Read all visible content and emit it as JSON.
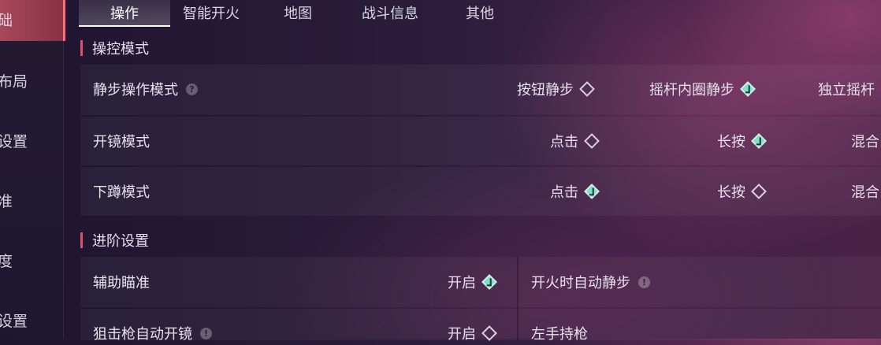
{
  "sidebar": {
    "items": [
      {
        "label": "础"
      },
      {
        "label": "布局"
      },
      {
        "label": "设置"
      },
      {
        "label": "准"
      },
      {
        "label": "度"
      },
      {
        "label": "设置"
      }
    ]
  },
  "tabs": [
    {
      "label": "操作"
    },
    {
      "label": "智能开火"
    },
    {
      "label": "地图"
    },
    {
      "label": "战斗信息"
    },
    {
      "label": "其他"
    }
  ],
  "sections": {
    "control_mode": {
      "title": "操控模式",
      "rows": [
        {
          "label": "静步操作模式",
          "help_icon": "?",
          "options": [
            {
              "label": "按钮静步",
              "checked": false
            },
            {
              "label": "摇杆内圈静步",
              "checked": true
            },
            {
              "label": "独立摇杆",
              "checked": false
            }
          ]
        },
        {
          "label": "开镜模式",
          "options": [
            {
              "label": "点击",
              "checked": false
            },
            {
              "label": "长按",
              "checked": true
            },
            {
              "label": "混合",
              "checked": false
            }
          ]
        },
        {
          "label": "下蹲模式",
          "options": [
            {
              "label": "点击",
              "checked": true
            },
            {
              "label": "长按",
              "checked": false
            },
            {
              "label": "混合",
              "checked": false
            }
          ]
        }
      ]
    },
    "advanced": {
      "title": "进阶设置",
      "rows": [
        {
          "label": "辅助瞄准",
          "option": {
            "label": "开启",
            "checked": true
          },
          "right_label": "开火时自动静步",
          "right_icon": "!"
        },
        {
          "label": "狙击枪自动开镜",
          "icon": "!",
          "option": {
            "label": "开启",
            "checked": false
          },
          "right_label": "左手持枪"
        }
      ]
    }
  },
  "colors": {
    "accent": "#e0506a",
    "check": "#7ee0c6"
  }
}
